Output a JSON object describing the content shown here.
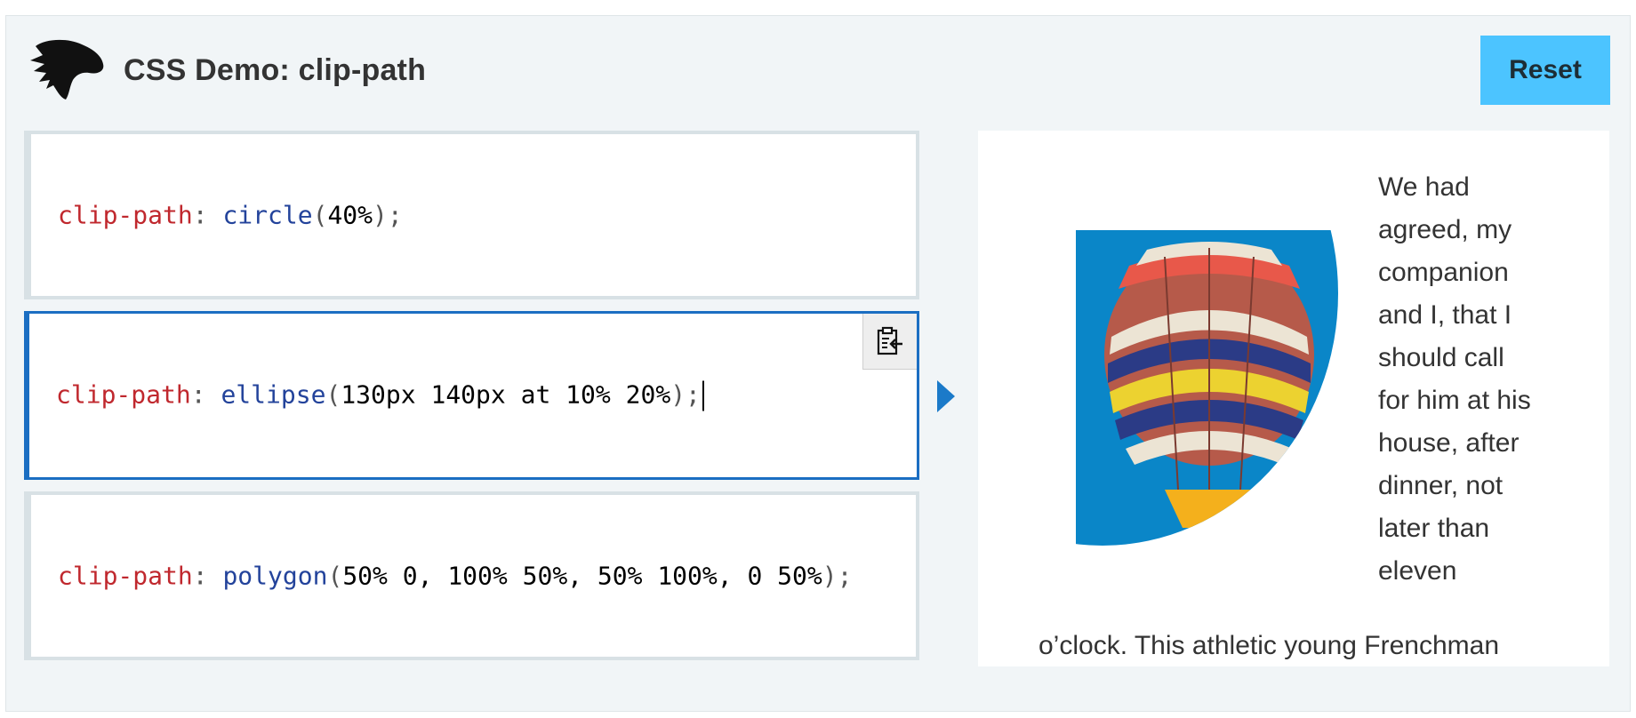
{
  "header": {
    "title": "CSS Demo: clip-path",
    "reset_label": "Reset"
  },
  "editor": {
    "choices": [
      {
        "property": "clip-path",
        "colon": ":",
        "function": "circle",
        "args": "40%",
        "tail": ");",
        "selected": false
      },
      {
        "property": "clip-path",
        "colon": ":",
        "function": "ellipse",
        "args": "130px 140px at 10% 20%",
        "tail": ");",
        "selected": true
      },
      {
        "property": "clip-path",
        "colon": ":",
        "function": "polygon",
        "args": "50% 0, 100% 50%, 50% 100%, 0 50%",
        "tail": ");",
        "selected": false
      }
    ],
    "copy_icon": "clipboard-copy-icon"
  },
  "output": {
    "paragraph_lines": [
      "We had",
      "agreed, my",
      "companion",
      "and I, that I",
      "should call",
      "for him at his",
      "house, after",
      "dinner, not",
      "later than",
      "eleven"
    ],
    "continued_line": "o’clock. This athletic young Frenchman"
  },
  "colors": {
    "accent": "#4cc4ff",
    "selected_border": "#1b6ec2",
    "property": "#c0282e",
    "function": "#23439b"
  }
}
